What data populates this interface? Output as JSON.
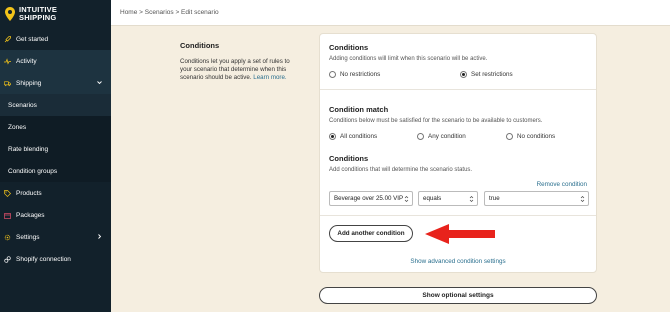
{
  "app": {
    "name_line1": "INTUITIVE",
    "name_line2": "SHIPPING"
  },
  "sidebar": {
    "items": [
      {
        "label": "Get started",
        "icon": "rocket-icon"
      },
      {
        "label": "Activity",
        "icon": "activity-icon"
      },
      {
        "label": "Shipping",
        "icon": "truck-icon"
      },
      {
        "label": "Products",
        "icon": "tag-icon"
      },
      {
        "label": "Packages",
        "icon": "box-icon"
      },
      {
        "label": "Settings",
        "icon": "gear-icon"
      },
      {
        "label": "Shopify connection",
        "icon": "link-icon"
      }
    ],
    "shipping_sub": [
      {
        "label": "Scenarios"
      },
      {
        "label": "Zones"
      },
      {
        "label": "Rate blending"
      },
      {
        "label": "Condition groups"
      }
    ]
  },
  "breadcrumb": {
    "text": "Home > Scenarios > Edit scenario"
  },
  "intro": {
    "title": "Conditions",
    "body": "Conditions let you apply a set of rules to your scenario that determine when this scenario should be active.",
    "link": "Learn more."
  },
  "conditions": {
    "title": "Conditions",
    "help": "Adding conditions will limit when this scenario will be active.",
    "options": [
      "No restrictions",
      "Set restrictions"
    ],
    "selected": "Set restrictions"
  },
  "match": {
    "title": "Condition match",
    "help": "Conditions below must be satisfied for the scenario to be available to customers.",
    "options": [
      "All conditions",
      "Any condition",
      "No conditions"
    ],
    "selected": "All conditions"
  },
  "rules": {
    "title": "Conditions",
    "help": "Add conditions that will determine the scenario status.",
    "remove_label": "Remove condition",
    "row": {
      "field": "Beverage over 25.00 VIP",
      "operator": "equals",
      "value": "true"
    },
    "add_label": "Add another condition",
    "advanced_label": "Show advanced condition settings"
  },
  "optional_label": "Show optional settings",
  "colors": {
    "sidebar": "#12212b",
    "background": "#f5eee0",
    "link": "#2a6f8e",
    "arrow": "#e8231c",
    "logo": "#f2c319"
  }
}
